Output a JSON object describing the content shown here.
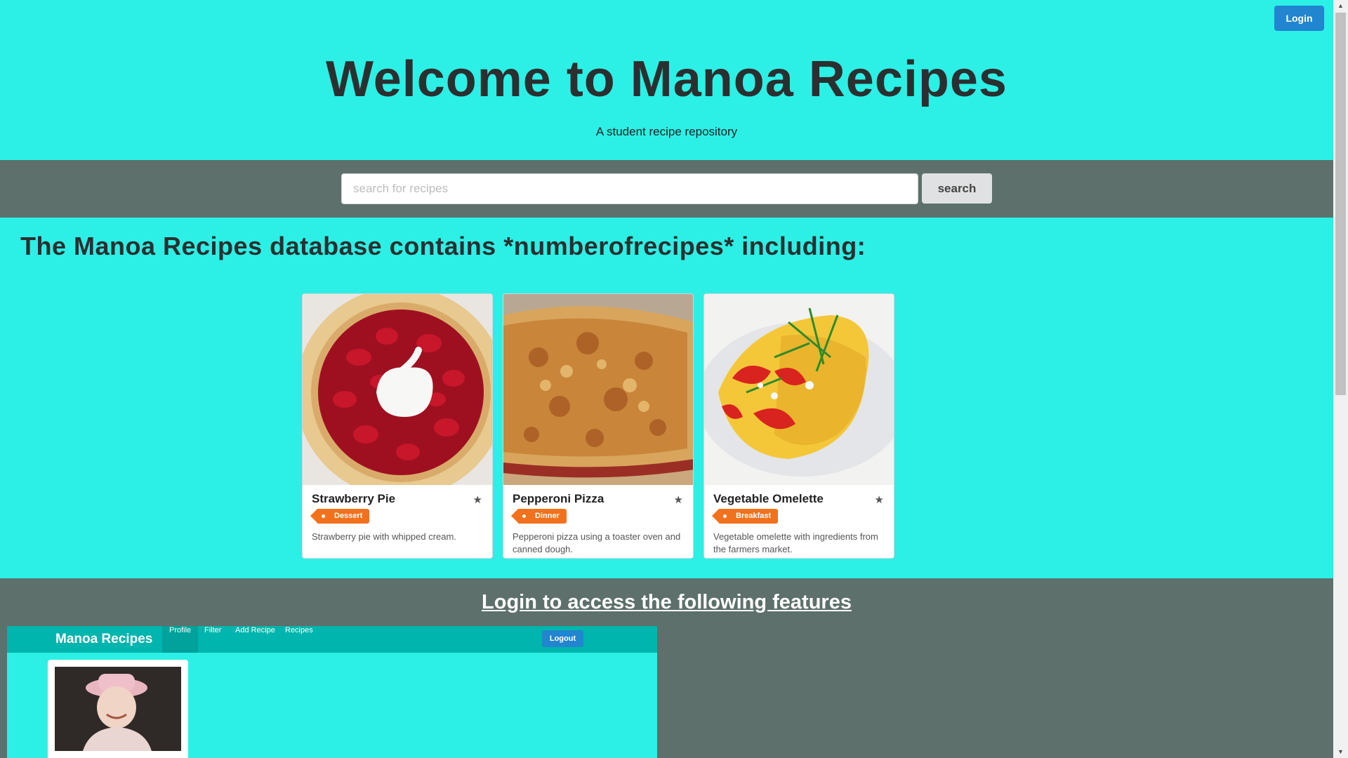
{
  "header": {
    "login_label": "Login"
  },
  "hero": {
    "title": "Welcome to Manoa Recipes",
    "subtitle": "A student recipe repository"
  },
  "search": {
    "placeholder": "search for recipes",
    "value": "",
    "button_label": "search"
  },
  "database_heading": "The Manoa Recipes database contains *numberofrecipes* including:",
  "recipes": [
    {
      "title": "Strawberry Pie",
      "tag": "Dessert",
      "description": "Strawberry pie with whipped cream."
    },
    {
      "title": "Pepperoni Pizza",
      "tag": "Dinner",
      "description": "Pepperoni pizza using a toaster oven and canned dough."
    },
    {
      "title": "Vegetable Omelette",
      "tag": "Breakfast",
      "description": "Vegetable omelette with ingredients from the farmers market."
    }
  ],
  "features": {
    "heading": "Login to access the following features",
    "preview": {
      "brand": "Manoa Recipes",
      "tabs": [
        "Profile",
        "Filter",
        "Add Recipe",
        "Recipes"
      ],
      "logout_label": "Logout"
    }
  },
  "colors": {
    "background": "#2cf0e6",
    "band": "#5d706b",
    "primary": "#2185d0",
    "tag": "#f2711c",
    "nav": "#00b5ad"
  },
  "icons": {
    "star": "star-icon",
    "scroll_up": "arrow-up-icon",
    "scroll_down": "arrow-down-icon"
  }
}
